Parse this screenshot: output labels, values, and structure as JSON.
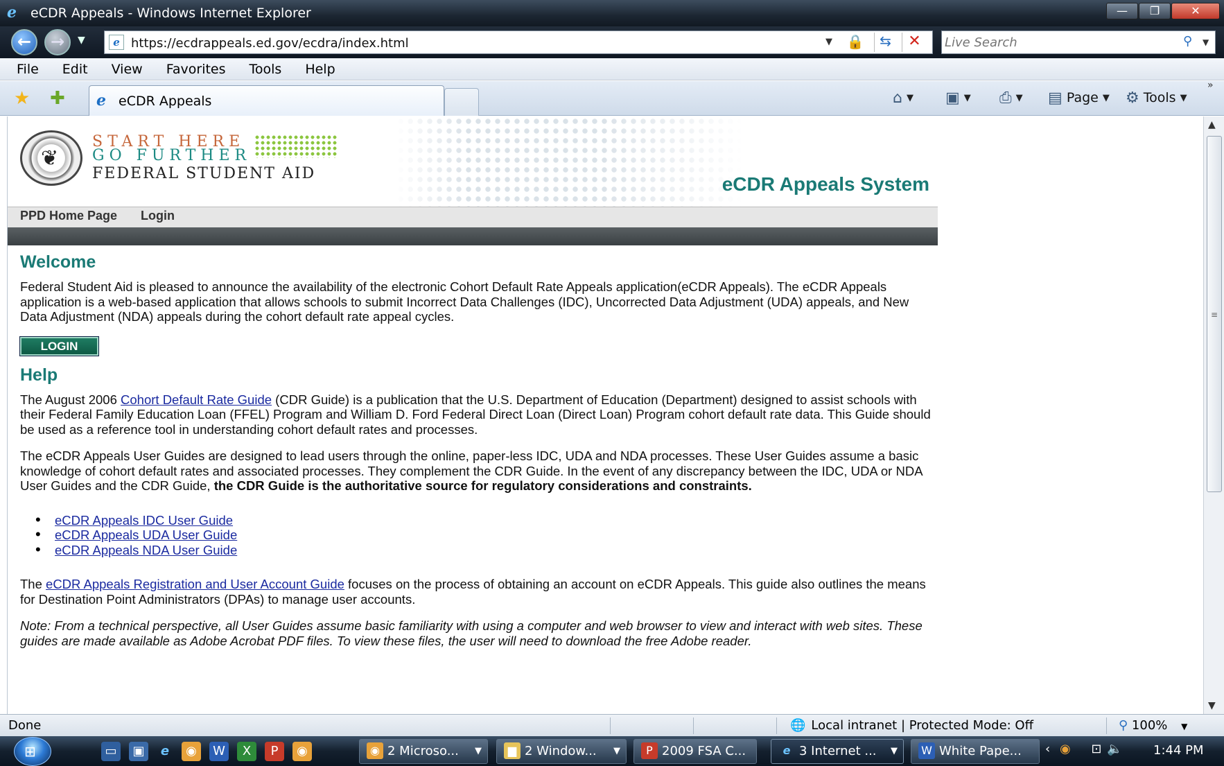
{
  "window": {
    "title": "eCDR Appeals - Windows Internet Explorer",
    "minimize": "—",
    "maximize": "❐",
    "close": "✕"
  },
  "addressbar": {
    "url": "https://ecdrappeals.ed.gov/ecdra/index.html",
    "search_placeholder": "Live Search"
  },
  "menu": [
    "File",
    "Edit",
    "View",
    "Favorites",
    "Tools",
    "Help"
  ],
  "tab": {
    "label": "eCDR Appeals"
  },
  "commands": {
    "page": "Page",
    "tools": "Tools"
  },
  "site": {
    "logo_line1": "START HERE",
    "logo_line2": "GO FURTHER",
    "logo_line3": "FEDERAL STUDENT AID",
    "title": "eCDR Appeals System",
    "nav": [
      "PPD Home Page",
      "Login"
    ]
  },
  "content": {
    "welcome_heading": "Welcome",
    "welcome_text": "Federal Student Aid is pleased to announce the availability of the electronic Cohort Default Rate Appeals application(eCDR Appeals). The eCDR Appeals application is a web-based application that allows schools to submit Incorrect Data Challenges (IDC), Uncorrected Data Adjustment (UDA) appeals, and New Data Adjustment (NDA) appeals during the cohort default rate appeal cycles.",
    "login_button": "LOGIN",
    "help_heading": "Help",
    "help_p1_pre": "The August 2006 ",
    "help_p1_link": "Cohort Default Rate Guide",
    "help_p1_post": " (CDR Guide) is a publication that the U.S. Department of Education (Department) designed to assist schools with their Federal Family Education Loan (FFEL) Program and William D. Ford Federal Direct Loan (Direct Loan) Program cohort default rate data. This Guide should be used as a reference tool in understanding cohort default rates and processes.",
    "help_p2": "The eCDR Appeals User Guides are designed to lead users through the online, paper-less IDC, UDA and NDA processes. These User Guides assume a basic knowledge of cohort default rates and associated processes. They complement the CDR Guide. In the event of any discrepancy between the IDC, UDA or NDA User Guides and the CDR Guide, ",
    "help_p2_bold": "the CDR Guide is the authoritative source for regulatory considerations and constraints.",
    "guides": [
      "eCDR Appeals IDC User Guide",
      "eCDR Appeals UDA User Guide",
      "eCDR Appeals NDA User Guide"
    ],
    "help_p3_pre": "The ",
    "help_p3_link": "eCDR Appeals Registration and User Account Guide",
    "help_p3_post": " focuses on the process of obtaining an account on eCDR Appeals. This guide also outlines the means for Destination Point Administrators (DPAs) to manage user accounts.",
    "note": "Note: From a technical perspective, all User Guides assume basic familiarity with using a computer and web browser to view and interact with web sites. These guides are made available as Adobe Acrobat PDF files. To view these files, the user will need to download the free Adobe reader."
  },
  "status": {
    "text": "Done",
    "zone": "Local intranet | Protected Mode: Off",
    "zoom": "100%"
  },
  "taskbar": {
    "buttons": [
      "2 Microso...",
      "2 Window...",
      "2009 FSA C...",
      "3 Internet ...",
      "White Pape..."
    ],
    "clock": "1:44 PM"
  }
}
